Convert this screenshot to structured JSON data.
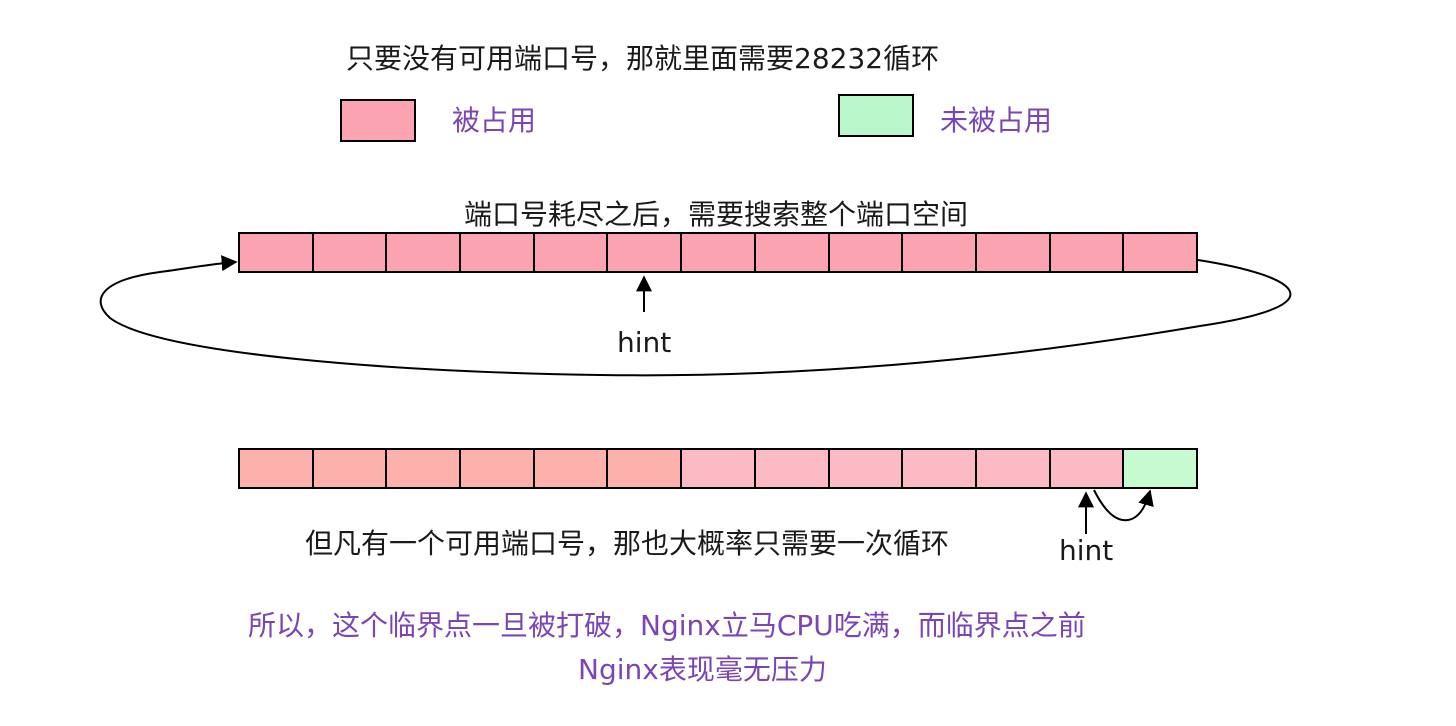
{
  "title": "只要没有可用端口号，那就里面需要28232循环",
  "legend": [
    {
      "label": "被占用",
      "color": "#fca3b1"
    },
    {
      "label": "未被占用",
      "color": "#b9f8cb"
    }
  ],
  "top_section": {
    "caption": "端口号耗尽之后，需要搜索整个端口空间",
    "cells": [
      "#fca3b1",
      "#fca3b1",
      "#fca3b1",
      "#fca3b1",
      "#fca3b1",
      "#fca3b1",
      "#fca3b1",
      "#fca3b1",
      "#fca3b1",
      "#fca3b1",
      "#fca3b1",
      "#fca3b1",
      "#fca3b1"
    ],
    "hint_label": "hint"
  },
  "bottom_section": {
    "caption": "但凡有一个可用端口号，那也大概率只需要一次循环",
    "cells": [
      "#fcb1ad",
      "#fcb1ad",
      "#fcb1ad",
      "#fcb1ad",
      "#fcb1ad",
      "#fcb1ad",
      "#fbbac4",
      "#fbbac4",
      "#fbbac4",
      "#fbbac4",
      "#fbbac4",
      "#fbbac4",
      "#c6fbd0"
    ],
    "hint_label": "hint"
  },
  "conclusion": {
    "line1": "所以，这个临界点一旦被打破，Nginx立马CPU吃满，而临界点之前",
    "line2": "Nginx表现毫无压力"
  }
}
